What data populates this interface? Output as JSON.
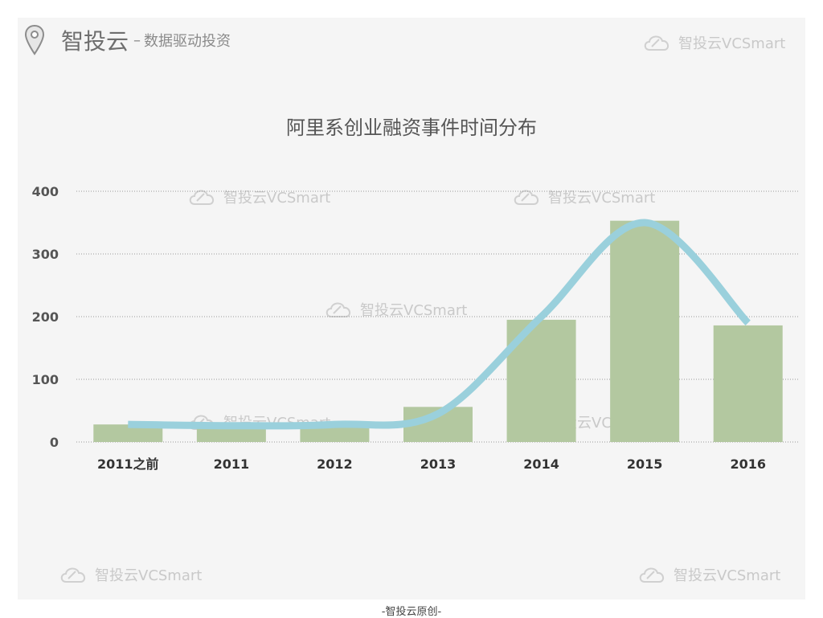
{
  "brand": {
    "name": "智投云",
    "dash": "–",
    "tagline": "数据驱动投资",
    "icon": "location-pin-icon"
  },
  "watermarks": [
    "智投云VCSmart",
    "智投云VCSmart",
    "智投云VCSmart",
    "智投云VCSmart",
    "智投云VCSmart",
    "智投云VCSmart",
    "智投云VCSmart",
    "智投云VCSmart"
  ],
  "footer": {
    "note": "-智投云原创-"
  },
  "colors": {
    "bar": "#b3c8a0",
    "curve": "#9ad0dc",
    "text": "#555555",
    "grid": "#999999",
    "background": "#f5f5f5"
  },
  "chart_data": {
    "type": "bar",
    "title": "阿里系创业融资事件时间分布",
    "categories": [
      "2011之前",
      "2011",
      "2012",
      "2013",
      "2014",
      "2015",
      "2016"
    ],
    "values": [
      28,
      24,
      25,
      56,
      195,
      353,
      186
    ],
    "xlabel": "",
    "ylabel": "",
    "ylim": [
      0,
      400
    ],
    "yticks": [
      0,
      100,
      200,
      300,
      400
    ],
    "grid": true,
    "legend": "none",
    "trend_line": {
      "type": "smooth",
      "values": [
        28,
        26,
        28,
        45,
        200,
        350,
        190
      ]
    }
  }
}
